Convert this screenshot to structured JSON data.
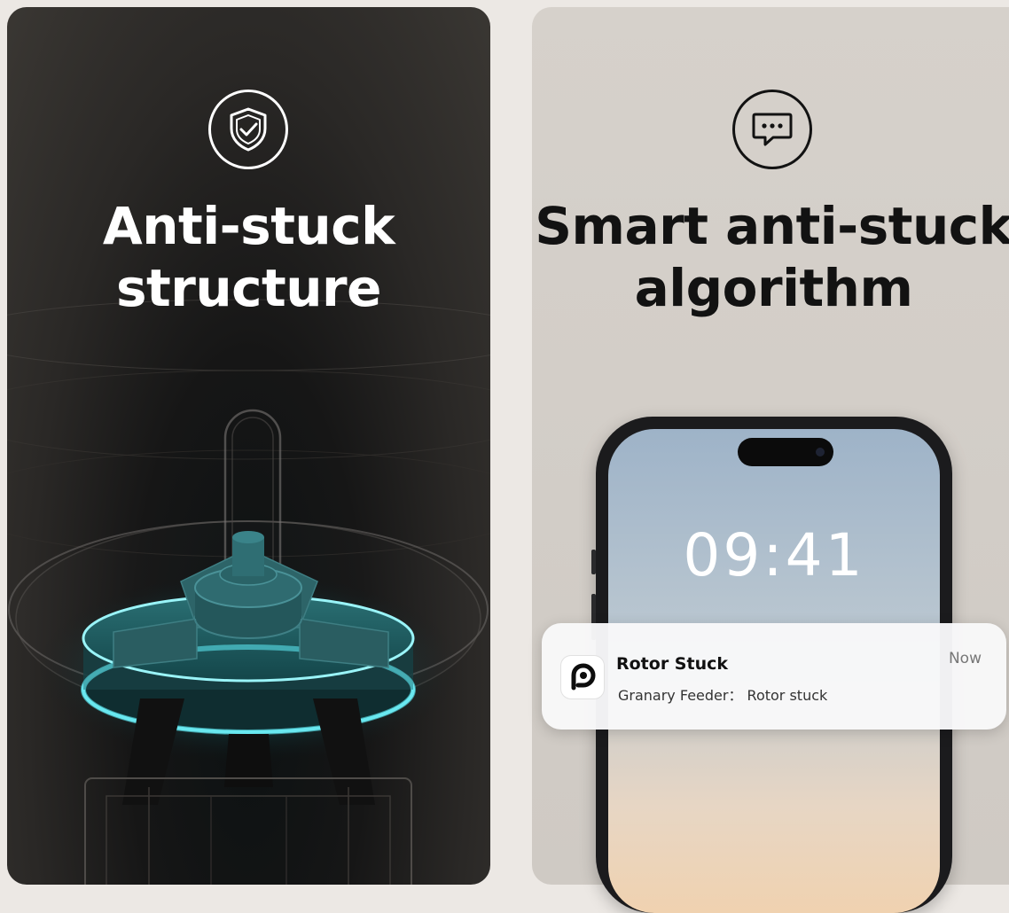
{
  "left_panel": {
    "icon": "shield-check-icon",
    "headline_line1": "Anti-stuck",
    "headline_line2": "structure",
    "accent_color": "#3fd6e0"
  },
  "right_panel": {
    "icon": "chat-bubble-icon",
    "headline_line1": "Smart anti-stuck",
    "headline_line2": "algorithm",
    "phone": {
      "clock": "09:41"
    },
    "notification": {
      "app_icon": "feeder-app-icon",
      "title": "Rotor Stuck",
      "body": "Granary Feeder： Rotor stuck",
      "time": "Now"
    }
  }
}
